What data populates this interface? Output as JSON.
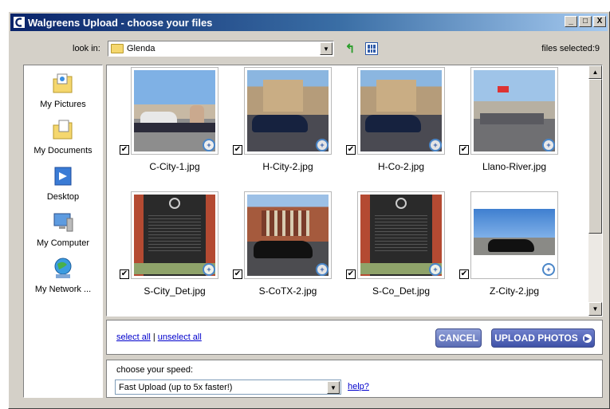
{
  "window": {
    "title": "Walgreens Upload - choose your files",
    "min_label": "_",
    "max_label": "□",
    "close_label": "X"
  },
  "toolbar": {
    "look_in_label": "look in:",
    "folder_value": "Glenda",
    "files_selected": "files selected:9"
  },
  "places": [
    {
      "label": "My Pictures",
      "icon": "my-pictures-icon"
    },
    {
      "label": "My Documents",
      "icon": "my-documents-icon"
    },
    {
      "label": "Desktop",
      "icon": "desktop-icon"
    },
    {
      "label": "My Computer",
      "icon": "my-computer-icon"
    },
    {
      "label": "My Network ...",
      "icon": "my-network-icon"
    }
  ],
  "files": [
    {
      "name": "C-City-1.jpg",
      "checked": true
    },
    {
      "name": "H-City-2.jpg",
      "checked": true
    },
    {
      "name": "H-Co-2.jpg",
      "checked": true
    },
    {
      "name": "Llano-River.jpg",
      "checked": true
    },
    {
      "name": "S-City_Det.jpg",
      "checked": true
    },
    {
      "name": "S-CoTX-2.jpg",
      "checked": true
    },
    {
      "name": "S-Co_Det.jpg",
      "checked": true
    },
    {
      "name": "Z-City-2.jpg",
      "checked": true
    }
  ],
  "actions": {
    "select_all": "select all",
    "separator": "|",
    "unselect_all": "unselect all",
    "cancel": "CANCEL",
    "upload": "UPLOAD PHOTOS"
  },
  "speed": {
    "label": "choose your speed:",
    "value": "Fast Upload (up to 5x faster!)",
    "help": "help?"
  },
  "colors": {
    "title_bar": "#0a246a",
    "button_blue": "#4f62b5",
    "link": "#0000cc"
  }
}
